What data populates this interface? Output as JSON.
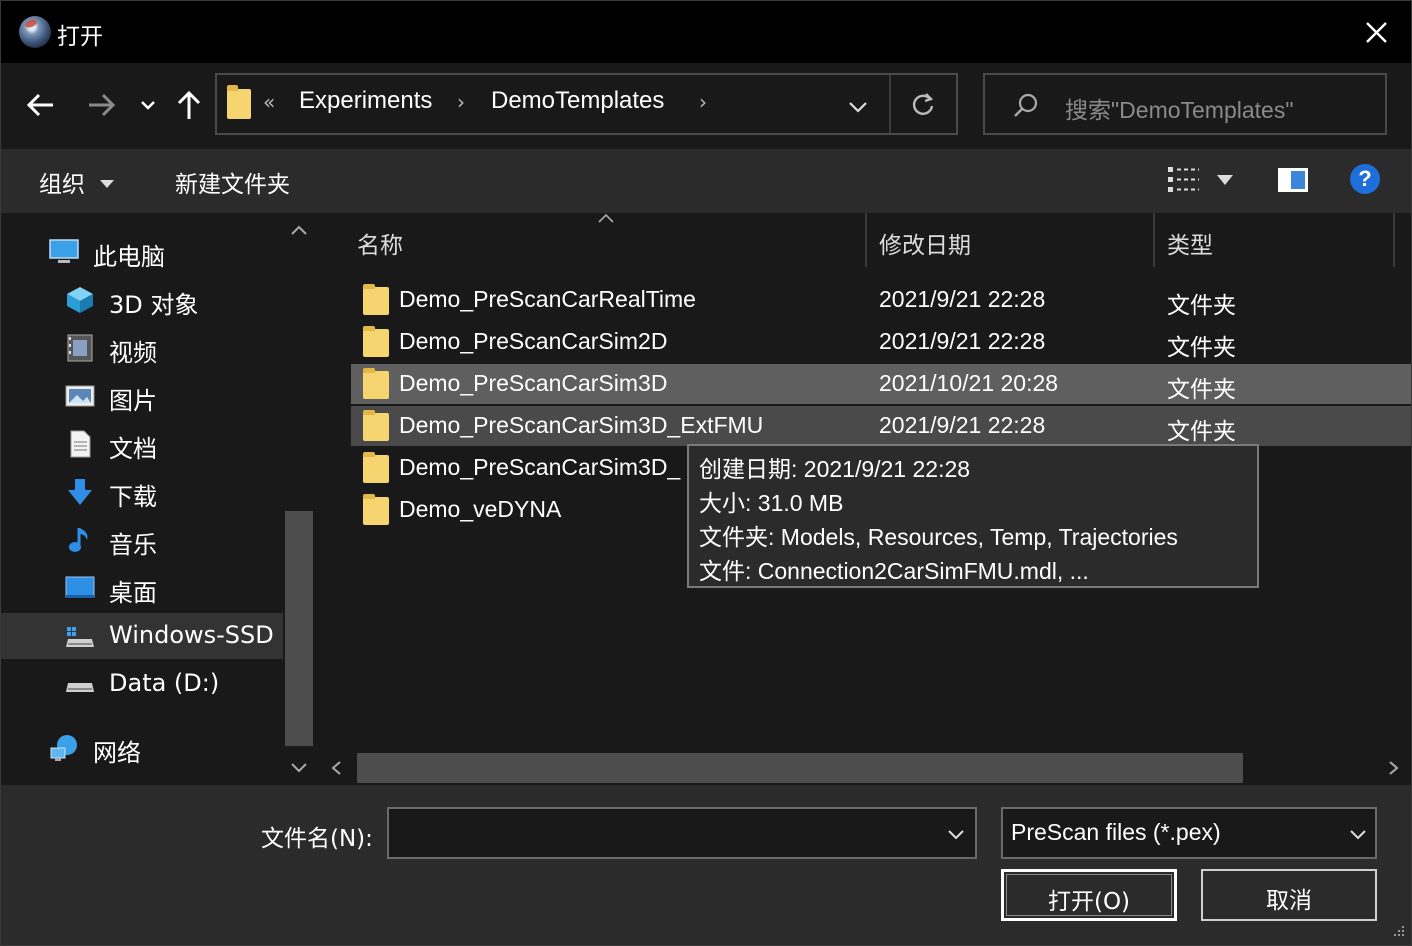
{
  "window": {
    "title": "打开"
  },
  "address_bar": {
    "overflow": "«",
    "crumbs": [
      "Experiments",
      "DemoTemplates"
    ],
    "separator": "›"
  },
  "search": {
    "placeholder": "搜索\"DemoTemplates\""
  },
  "toolbar": {
    "organize_label": "组织",
    "new_folder_label": "新建文件夹"
  },
  "sidebar": {
    "items": [
      {
        "label": "此电脑",
        "icon": "computer-icon"
      },
      {
        "label": "3D 对象",
        "icon": "cube-3d-icon"
      },
      {
        "label": "视频",
        "icon": "video-icon"
      },
      {
        "label": "图片",
        "icon": "picture-icon"
      },
      {
        "label": "文档",
        "icon": "document-icon"
      },
      {
        "label": "下载",
        "icon": "download-icon"
      },
      {
        "label": "音乐",
        "icon": "music-icon"
      },
      {
        "label": "桌面",
        "icon": "desktop-icon"
      },
      {
        "label": "Windows-SSD",
        "icon": "drive-icon",
        "selected": true
      },
      {
        "label": "Data (D:)",
        "icon": "drive-icon"
      },
      {
        "label": "网络",
        "icon": "network-icon"
      }
    ]
  },
  "file_list": {
    "columns": [
      "名称",
      "修改日期",
      "类型"
    ],
    "rows": [
      {
        "name": "Demo_PreScanCarRealTime",
        "date": "2021/9/21 22:28",
        "type": "文件夹"
      },
      {
        "name": "Demo_PreScanCarSim2D",
        "date": "2021/9/21 22:28",
        "type": "文件夹"
      },
      {
        "name": "Demo_PreScanCarSim3D",
        "date": "2021/10/21 20:28",
        "type": "文件夹"
      },
      {
        "name": "Demo_PreScanCarSim3D_ExtFMU",
        "date": "2021/9/21 22:28",
        "type": "文件夹"
      },
      {
        "name": "Demo_PreScanCarSim3D_",
        "date": "",
        "type": ""
      },
      {
        "name": "Demo_veDYNA",
        "date": "",
        "type": ""
      }
    ]
  },
  "tooltip": {
    "created": "创建日期: 2021/9/21 22:28",
    "size": "大小: 31.0 MB",
    "folders": "文件夹: Models, Resources, Temp, Trajectories",
    "files": "文件: Connection2CarSimFMU.mdl, ..."
  },
  "bottom": {
    "filename_label": "文件名(N):",
    "filename_value": "",
    "filter_value": "PreScan files (*.pex)",
    "open_label": "打开(O)",
    "cancel_label": "取消"
  },
  "colors": {
    "folder": "#f6d470",
    "help": "#1e6fd9",
    "background": "#191919",
    "toolbar": "#2b2b2b"
  }
}
